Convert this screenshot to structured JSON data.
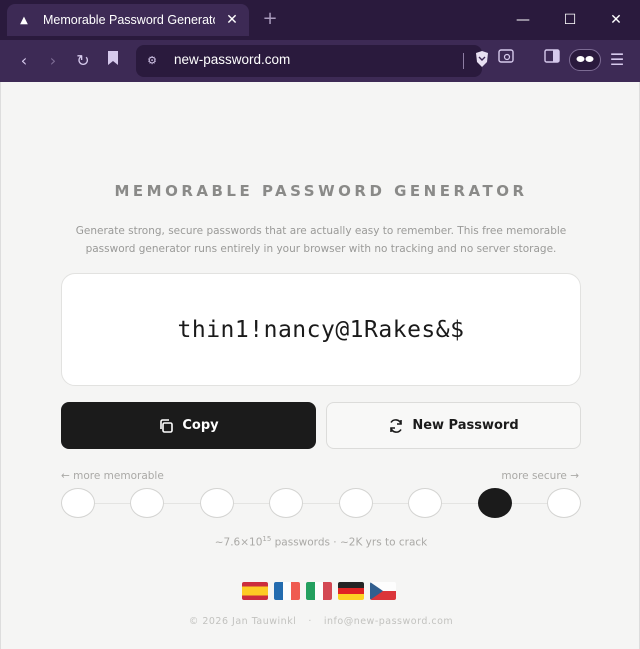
{
  "browser": {
    "tab_title": "Memorable Password Generator",
    "url": "new-password.com",
    "window_controls": [
      "minimize",
      "maximize",
      "close"
    ],
    "colors": {
      "titlebar": "#2a1a3d",
      "toolbar": "#3d2a55"
    }
  },
  "page": {
    "title": "MEMORABLE PASSWORD GENERATOR",
    "subtitle": "Generate strong, secure passwords that are actually easy to remember. This free memorable password generator runs entirely in your browser with no tracking and no server storage.",
    "password": "thin1!nancy@1Rakes&$",
    "copy_label": "Copy",
    "new_label": "New Password",
    "slider": {
      "left_label": "← more memorable",
      "right_label": "more secure →",
      "steps": 8,
      "selected_index": 6
    },
    "stats_prefix": "~7.6×10",
    "stats_exp": "15",
    "stats_suffix": " passwords · ~2K yrs to crack",
    "languages": [
      "es",
      "fr",
      "it",
      "de",
      "cz"
    ],
    "footer_copyright": "© 2026 Jan Tauwinkl",
    "footer_separator": "·",
    "footer_email": "info@new-password.com"
  }
}
